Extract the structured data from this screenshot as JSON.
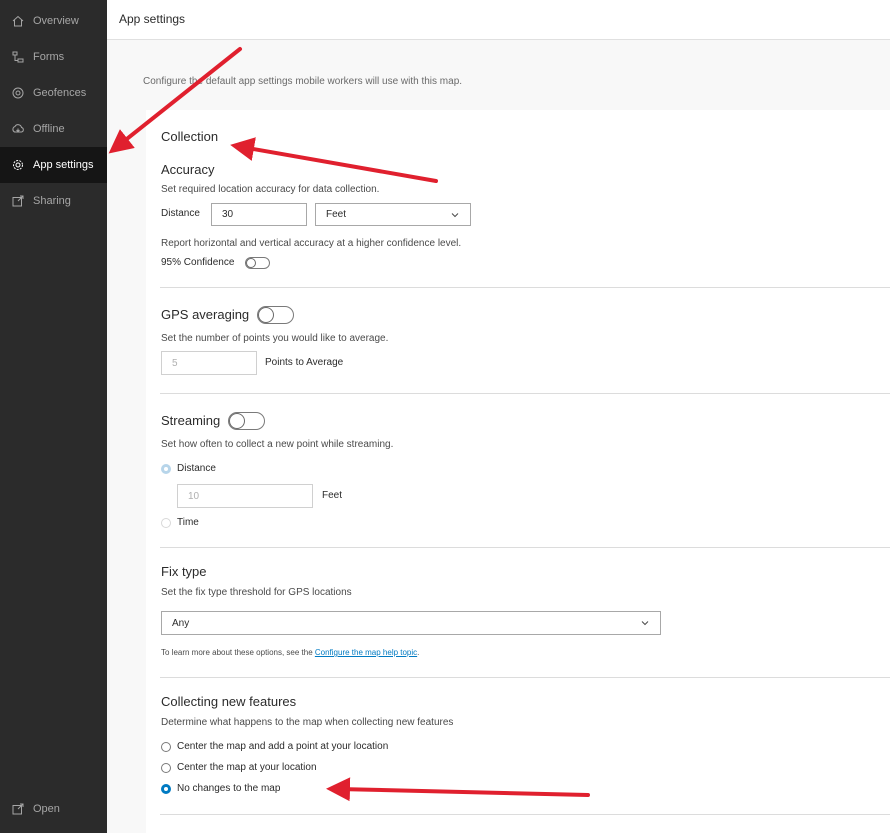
{
  "sidebar": {
    "items": [
      {
        "label": "Overview",
        "icon": "home-icon"
      },
      {
        "label": "Forms",
        "icon": "forms-icon"
      },
      {
        "label": "Geofences",
        "icon": "geofence-icon"
      },
      {
        "label": "Offline",
        "icon": "offline-icon"
      },
      {
        "label": "App settings",
        "icon": "gear-icon",
        "active": true
      },
      {
        "label": "Sharing",
        "icon": "share-icon"
      }
    ],
    "footer": {
      "label": "Open",
      "icon": "open-icon"
    }
  },
  "header": {
    "title": "App settings"
  },
  "intro": "Configure the default app settings mobile workers will use with this map.",
  "collection": {
    "heading": "Collection",
    "accuracy": {
      "title": "Accuracy",
      "desc": "Set required location accuracy for data collection.",
      "distance_label": "Distance",
      "distance_value": "30",
      "unit": "Feet",
      "confidence_desc": "Report horizontal and vertical accuracy at a higher confidence level.",
      "confidence_label": "95% Confidence",
      "confidence_on": false
    },
    "gps_averaging": {
      "title": "GPS averaging",
      "enabled": false,
      "desc": "Set the number of points you would like to average.",
      "points_value": "5",
      "points_label": "Points to Average"
    },
    "streaming": {
      "title": "Streaming",
      "enabled": false,
      "desc": "Set how often to collect a new point while streaming.",
      "option_distance": "Distance",
      "distance_value": "10",
      "distance_unit": "Feet",
      "option_time": "Time"
    },
    "fix_type": {
      "title": "Fix type",
      "desc": "Set the fix type threshold for GPS locations",
      "value": "Any",
      "help_prefix": "To learn more about these options, see the ",
      "help_link": "Configure the map help topic",
      "help_suffix": "."
    },
    "new_features": {
      "title": "Collecting new features",
      "desc": "Determine what happens to the map when collecting new features",
      "options": [
        {
          "label": "Center the map and add a point at your location",
          "checked": false
        },
        {
          "label": "Center the map at your location",
          "checked": false
        },
        {
          "label": "No changes to the map",
          "checked": true
        }
      ]
    }
  },
  "colors": {
    "accent": "#007ac2",
    "annotation_arrow": "#e0202e",
    "sidebar_bg": "#2b2b2b"
  }
}
